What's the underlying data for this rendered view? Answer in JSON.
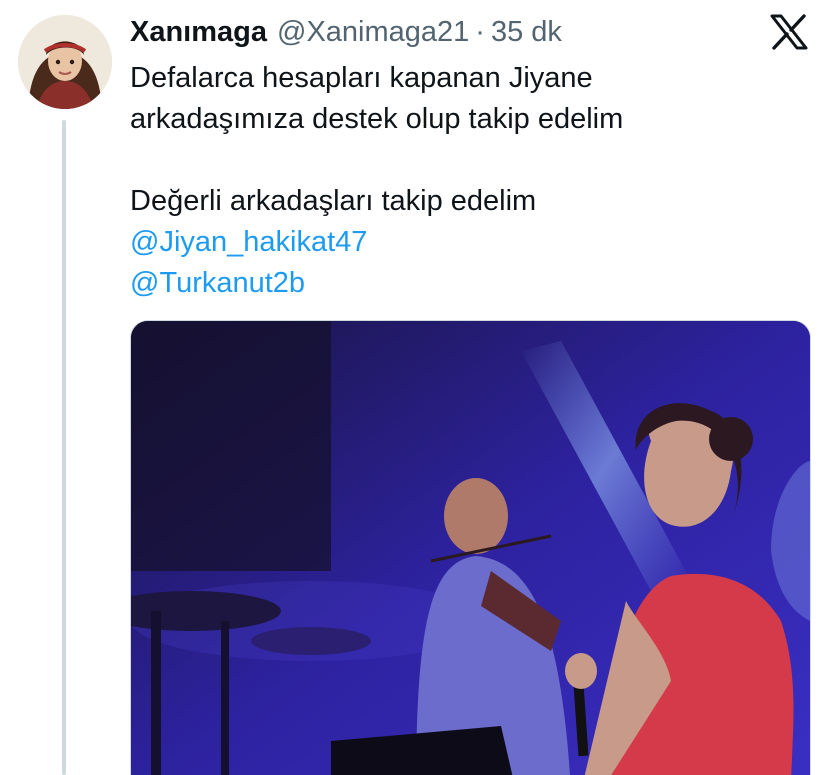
{
  "author": {
    "display_name": "Xanımaga",
    "handle": "@Xanimaga21",
    "separator": "·",
    "time": "35 dk"
  },
  "icons": {
    "platform_logo": "x-logo-icon",
    "avatar": "profile-avatar"
  },
  "tweet": {
    "line1": "Defalarca hesapları kapanan Jiyane",
    "line2": "arkadaşımıza destek olup takip edelim",
    "line3": "Değerli arkadaşları takip edelim",
    "mention1": " @Jiyan_hakikat47",
    "mention2": "@Turkanut2b"
  },
  "colors": {
    "text": "#0f1419",
    "secondary": "#536471",
    "link": "#1d9bf0",
    "thread_line": "#cfd9de"
  }
}
